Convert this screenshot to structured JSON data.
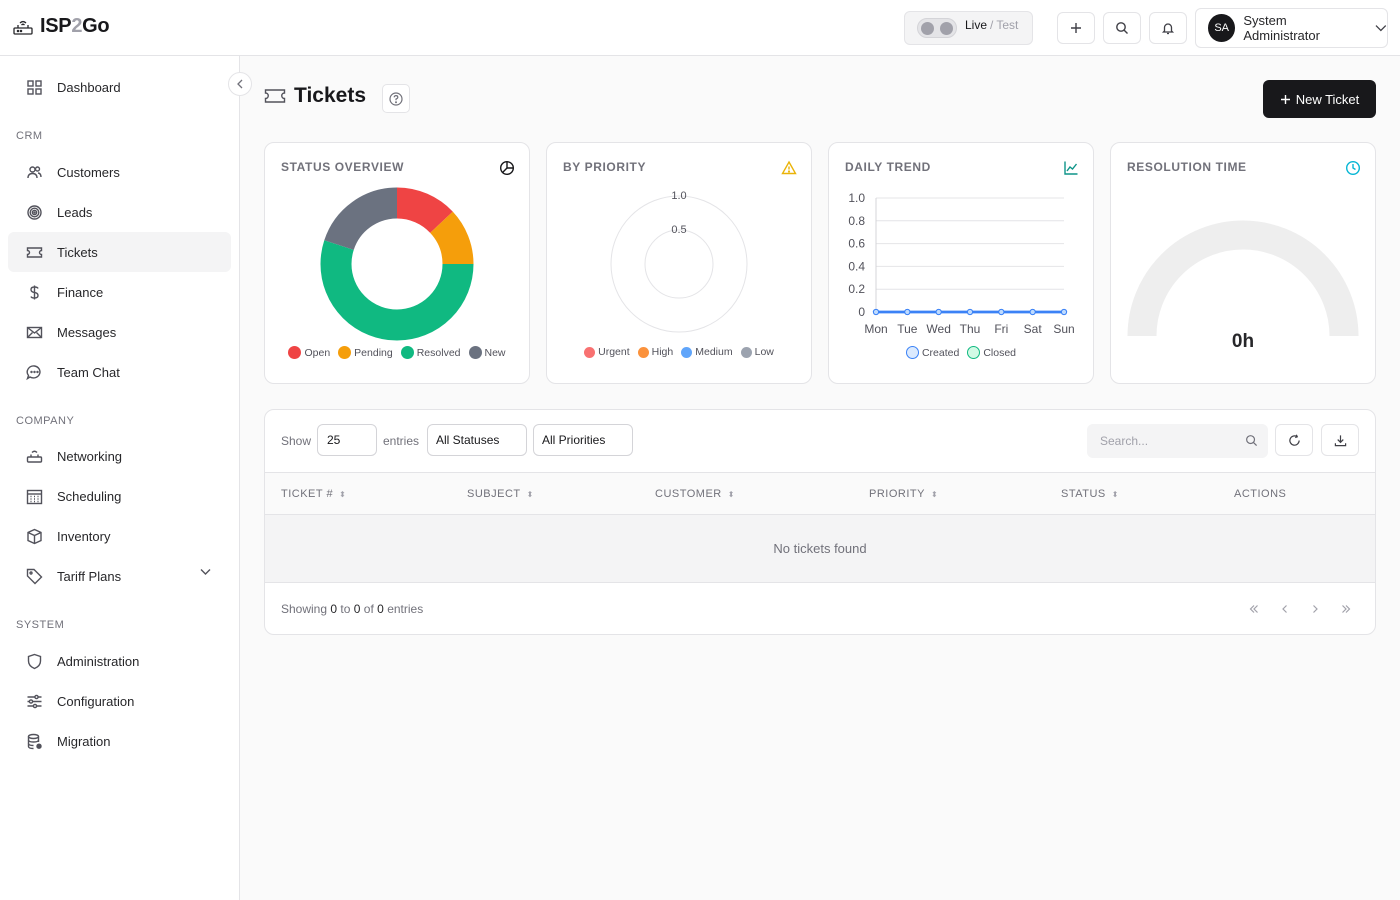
{
  "app": {
    "logo_main": "ISP",
    "logo_two": "2",
    "logo_end": "Go"
  },
  "env": {
    "live": "Live",
    "sep": "/",
    "test": "Test"
  },
  "user": {
    "initials": "SA",
    "name": "System Administrator"
  },
  "sidebar": {
    "dashboard": "Dashboard",
    "sections": {
      "crm": "CRM",
      "company": "COMPANY",
      "system": "SYSTEM"
    },
    "crm_items": [
      "Customers",
      "Leads",
      "Tickets",
      "Finance",
      "Messages",
      "Team Chat"
    ],
    "company_items": [
      "Networking",
      "Scheduling",
      "Inventory",
      "Tariff Plans"
    ],
    "system_items": [
      "Administration",
      "Configuration",
      "Migration"
    ]
  },
  "page": {
    "title": "Tickets",
    "new_button": "New Ticket"
  },
  "colors": {
    "open": "#ef4444",
    "pending": "#f59e0b",
    "resolved": "#10b981",
    "new": "#6b7280",
    "urgent": "#f87171",
    "high": "#fb923c",
    "medium": "#60a5fa",
    "low": "#9ca3af",
    "trend_line": "#3b82f6"
  },
  "cards": {
    "status": {
      "title": "STATUS OVERVIEW",
      "legend": [
        "Open",
        "Pending",
        "Resolved",
        "New"
      ]
    },
    "priority": {
      "title": "BY PRIORITY",
      "ticks": [
        "1.0",
        "0.5"
      ],
      "legend": [
        "Urgent",
        "High",
        "Medium",
        "Low"
      ]
    },
    "trend": {
      "title": "DAILY TREND",
      "legend": [
        "Created",
        "Closed"
      ]
    },
    "resolution": {
      "title": "RESOLUTION TIME",
      "value": "0h"
    }
  },
  "chart_data": [
    {
      "type": "pie",
      "categories": [
        "Open",
        "Pending",
        "Resolved",
        "New"
      ],
      "values": [
        13,
        12,
        55,
        20
      ]
    },
    {
      "type": "line",
      "x": [
        "Mon",
        "Tue",
        "Wed",
        "Thu",
        "Fri",
        "Sat",
        "Sun"
      ],
      "ylim": [
        0,
        1.0
      ],
      "yticks": [
        "1.0",
        "0.8",
        "0.6",
        "0.4",
        "0.2",
        "0"
      ],
      "series": [
        {
          "name": "Created",
          "values": [
            0,
            0,
            0,
            0,
            0,
            0,
            0
          ]
        },
        {
          "name": "Closed",
          "values": [
            0,
            0,
            0,
            0,
            0,
            0,
            0
          ]
        }
      ],
      "grid": true
    }
  ],
  "table": {
    "show_label": "Show",
    "entries_value": "25",
    "entries_label": "entries",
    "status_filter": "All Statuses",
    "priority_filter": "All Priorities",
    "search_placeholder": "Search...",
    "columns": [
      "TICKET #",
      "SUBJECT",
      "CUSTOMER",
      "PRIORITY",
      "STATUS",
      "ACTIONS"
    ],
    "empty_text": "No tickets found",
    "footer": {
      "showing": "Showing",
      "from": "0",
      "to_word": "to",
      "to": "0",
      "of_word": "of",
      "total": "0",
      "entries_word": "entries"
    }
  }
}
